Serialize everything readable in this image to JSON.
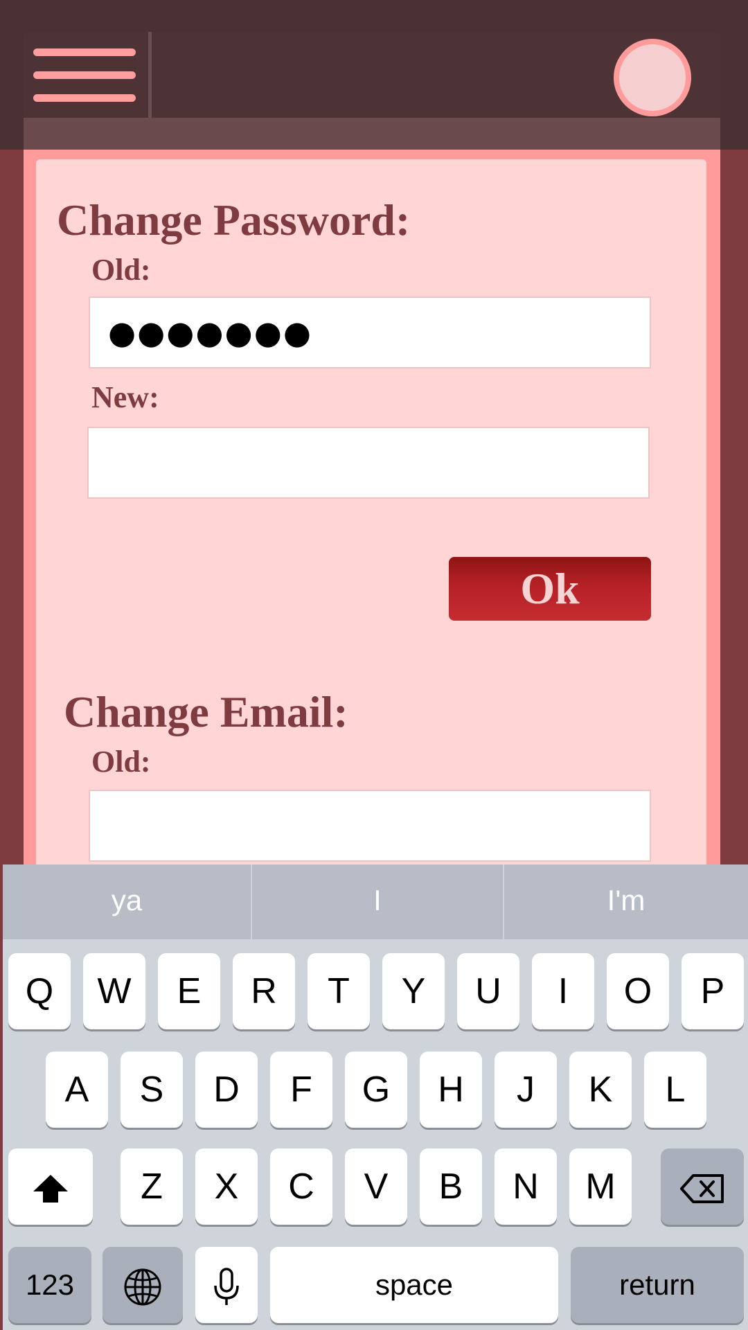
{
  "header": {
    "menu_icon": "hamburger-menu-icon",
    "avatar_icon": "avatar-circle"
  },
  "change_password": {
    "title": "Change Password:",
    "old_label": "Old:",
    "old_value": "●●●●●●●",
    "new_label": "New:",
    "new_value": "",
    "ok_label": "Ok"
  },
  "change_email": {
    "title": "Change Email:",
    "old_label": "Old:",
    "old_value": ""
  },
  "keyboard": {
    "suggestions": [
      "ya",
      "I",
      "I'm"
    ],
    "row1": [
      "Q",
      "W",
      "E",
      "R",
      "T",
      "Y",
      "U",
      "I",
      "O",
      "P"
    ],
    "row2": [
      "A",
      "S",
      "D",
      "F",
      "G",
      "H",
      "J",
      "K",
      "L"
    ],
    "row3": [
      "Z",
      "X",
      "C",
      "V",
      "B",
      "N",
      "M"
    ],
    "numbers_label": "123",
    "space_label": "space",
    "return_label": "return"
  },
  "colors": {
    "background": "#7e3c40",
    "panel": "#ffd5d5",
    "accent": "#ff9b9b",
    "button": "#b72126"
  }
}
